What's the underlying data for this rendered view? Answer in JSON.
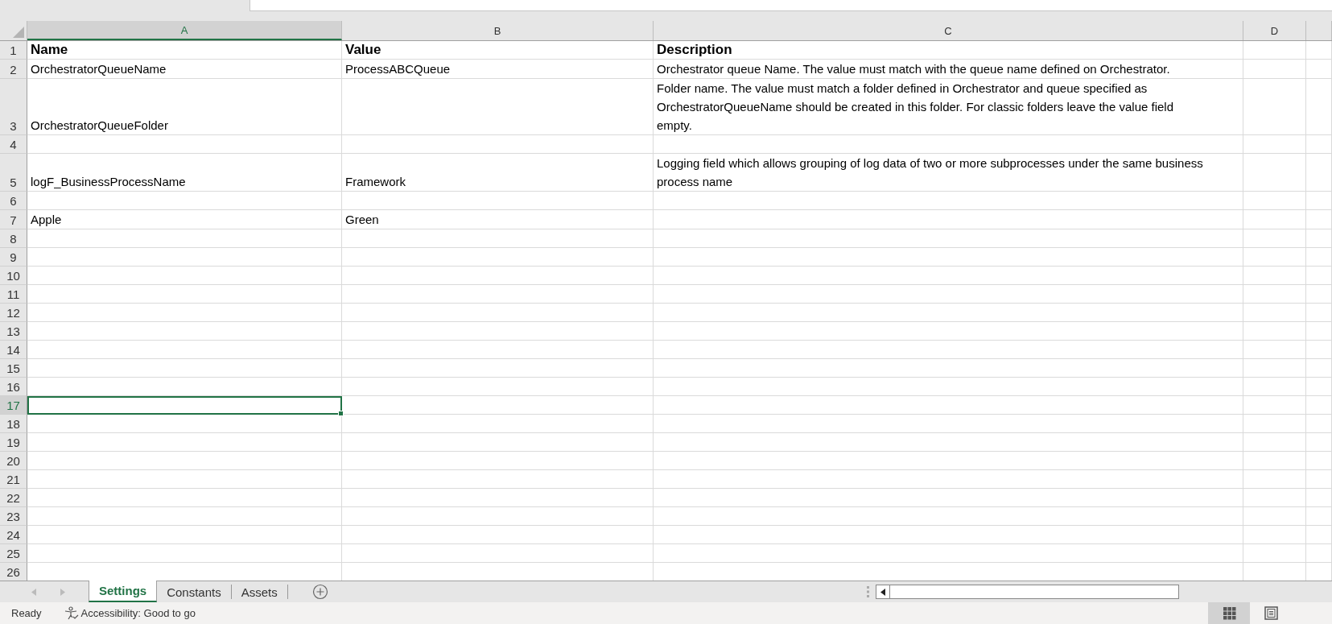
{
  "columns": [
    {
      "label": "A",
      "selected": true
    },
    {
      "label": "B",
      "selected": false
    },
    {
      "label": "C",
      "selected": false
    },
    {
      "label": "D",
      "selected": false
    }
  ],
  "header_row": {
    "number": "1",
    "selected": false,
    "name": "Name",
    "value": "Value",
    "description": "Description"
  },
  "rows": [
    {
      "number": "2",
      "selected": false,
      "name": "OrchestratorQueueName",
      "value": "ProcessABCQueue",
      "description": "Orchestrator queue Name. The value must match with the queue name defined on Orchestrator."
    },
    {
      "number": "3",
      "selected": false,
      "name": "OrchestratorQueueFolder",
      "description": "Folder name. The value must match a folder defined in Orchestrator and queue specified as OrchestratorQueueName should be created in this folder. For classic folders leave the value field empty."
    },
    {
      "number": "4",
      "selected": false
    },
    {
      "number": "5",
      "selected": false,
      "name": "logF_BusinessProcessName",
      "value": "Framework",
      "description": "Logging field which allows grouping of log data of two or more subprocesses under the same business process name"
    },
    {
      "number": "6",
      "selected": false
    },
    {
      "number": "7",
      "selected": false,
      "name": "Apple",
      "value": "Green"
    },
    {
      "number": "8",
      "selected": false
    },
    {
      "number": "9",
      "selected": false
    },
    {
      "number": "10",
      "selected": false
    },
    {
      "number": "11",
      "selected": false
    },
    {
      "number": "12",
      "selected": false
    },
    {
      "number": "13",
      "selected": false
    },
    {
      "number": "14",
      "selected": false
    },
    {
      "number": "15",
      "selected": false
    },
    {
      "number": "16",
      "selected": false
    },
    {
      "number": "17",
      "selected": true
    },
    {
      "number": "18",
      "selected": false
    },
    {
      "number": "19",
      "selected": false
    },
    {
      "number": "20",
      "selected": false
    },
    {
      "number": "21",
      "selected": false
    },
    {
      "number": "22",
      "selected": false
    },
    {
      "number": "23",
      "selected": false
    },
    {
      "number": "24",
      "selected": false
    },
    {
      "number": "25",
      "selected": false
    },
    {
      "number": "26",
      "selected": false
    }
  ],
  "sheet_tabs": [
    {
      "label": "Settings",
      "selected": true
    },
    {
      "label": "Constants",
      "selected": false
    },
    {
      "label": "Assets",
      "selected": false
    }
  ],
  "status_bar": {
    "status": "Ready",
    "accessibility": "Accessibility: Good to go"
  },
  "view_buttons": [
    {
      "kind": "normal",
      "selected": true
    },
    {
      "kind": "page_layout",
      "selected": false
    }
  ]
}
